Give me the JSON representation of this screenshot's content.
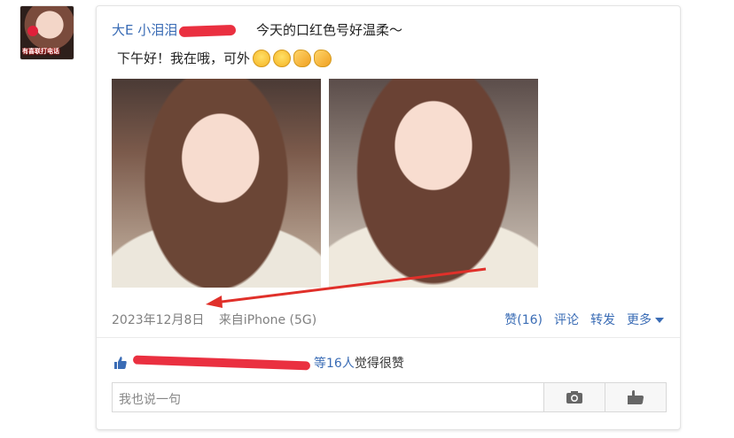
{
  "post": {
    "username": "大E 小泪泪",
    "title": "今天的口红色号好温柔～",
    "text": "下午好！我在哦，可外",
    "date": "2023年12月8日",
    "source": "来自iPhone (5G)"
  },
  "actions": {
    "like": "赞(16)",
    "comment": "评论",
    "repost": "转发",
    "more": "更多"
  },
  "likes": {
    "count_text": "等16人",
    "suffix": "觉得很赞"
  },
  "comment_input": {
    "placeholder": "我也说一句"
  },
  "avatar": {
    "overlay_text": "有喜联打电话"
  },
  "colors": {
    "link": "#3a6cb5",
    "redaction": "#ea3040",
    "arrow": "#e0302a"
  }
}
